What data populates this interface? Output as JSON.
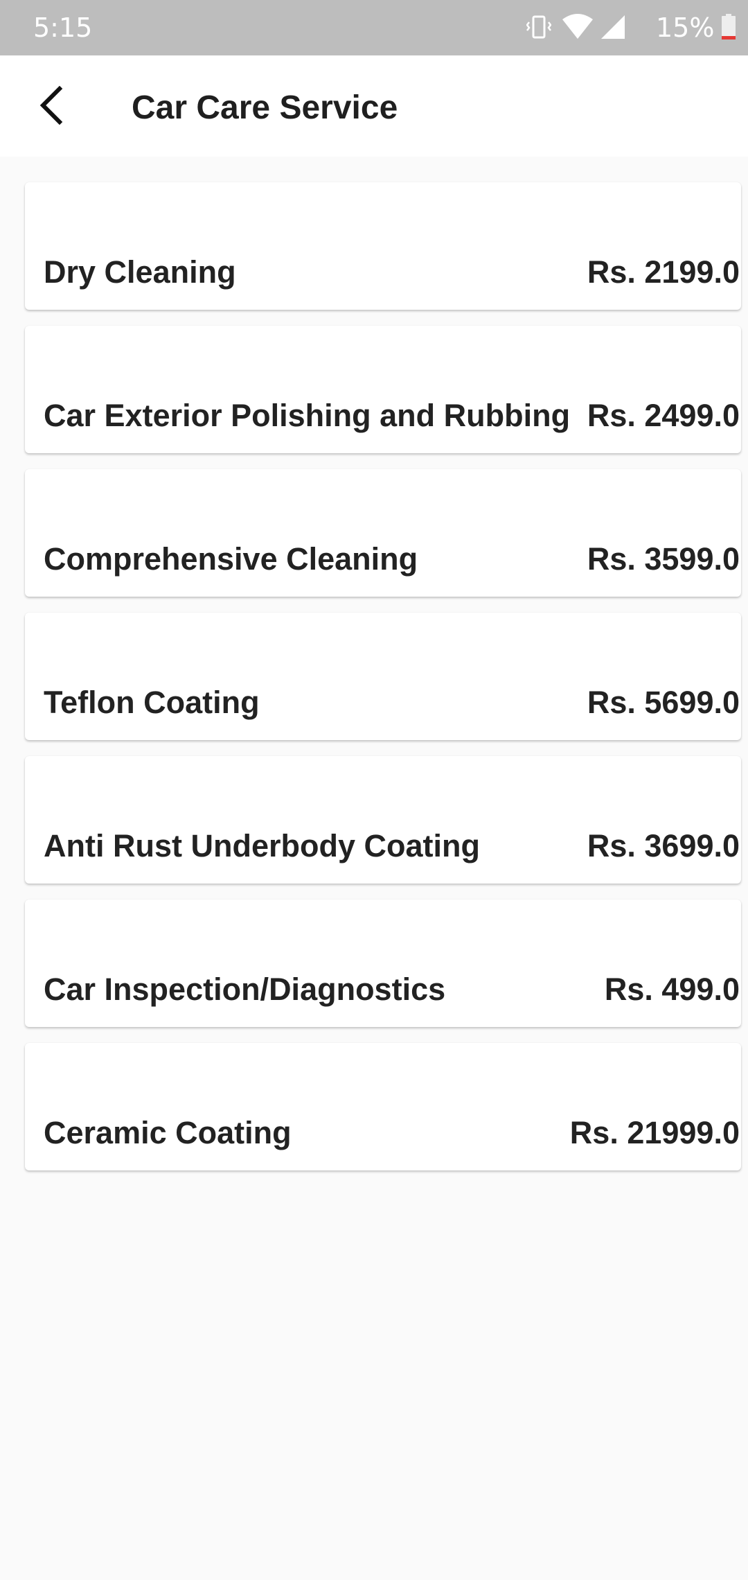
{
  "status_bar": {
    "time": "5:15",
    "battery_percent": "15%",
    "icons": [
      "vibrate-icon",
      "wifi-icon",
      "signal-icon",
      "battery-low-icon"
    ],
    "battery_color": "#e53935"
  },
  "app_bar": {
    "title": "Car Care Service",
    "back_icon": "back-arrow-icon"
  },
  "services": [
    {
      "name": "Dry Cleaning",
      "price": "Rs. 2199.0"
    },
    {
      "name": "Car Exterior Polishing and Rubbing",
      "price": "Rs. 2499.0"
    },
    {
      "name": "Comprehensive Cleaning",
      "price": "Rs. 3599.0"
    },
    {
      "name": "Teflon Coating",
      "price": "Rs. 5699.0"
    },
    {
      "name": "Anti Rust Underbody Coating",
      "price": "Rs. 3699.0"
    },
    {
      "name": "Car Inspection/Diagnostics",
      "price": "Rs. 499.0"
    },
    {
      "name": "Ceramic Coating",
      "price": "Rs. 21999.0"
    }
  ]
}
